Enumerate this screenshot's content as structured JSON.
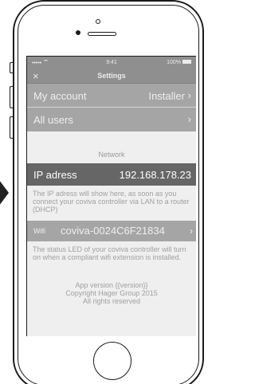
{
  "statusbar": {
    "carrier": "•••••",
    "time": "9:41",
    "battery": "100%"
  },
  "navbar": {
    "close_icon": "×",
    "title": "Settings"
  },
  "account_row": {
    "label": "My account",
    "value": "Installer",
    "chevron": "›"
  },
  "users_row": {
    "label": "All users",
    "chevron": "›"
  },
  "network": {
    "section_title": "Network"
  },
  "ip_row": {
    "label": "IP adress",
    "value": "192.168.178.23"
  },
  "ip_note": "The IP adress will show here, as soon as you connect your coviva controller via LAN to a router (DHCP)",
  "wifi_row": {
    "label": "Wifi",
    "value": "coviva-0024C6F21834",
    "chevron": "›"
  },
  "wifi_note": "The status LED of your coviva controller will turn on when a compliant wifi extension is installed.",
  "footer": {
    "line1": "App version {{version}}",
    "line2": "Copyright Hager Group 2015",
    "line3": "All rights reserved"
  }
}
